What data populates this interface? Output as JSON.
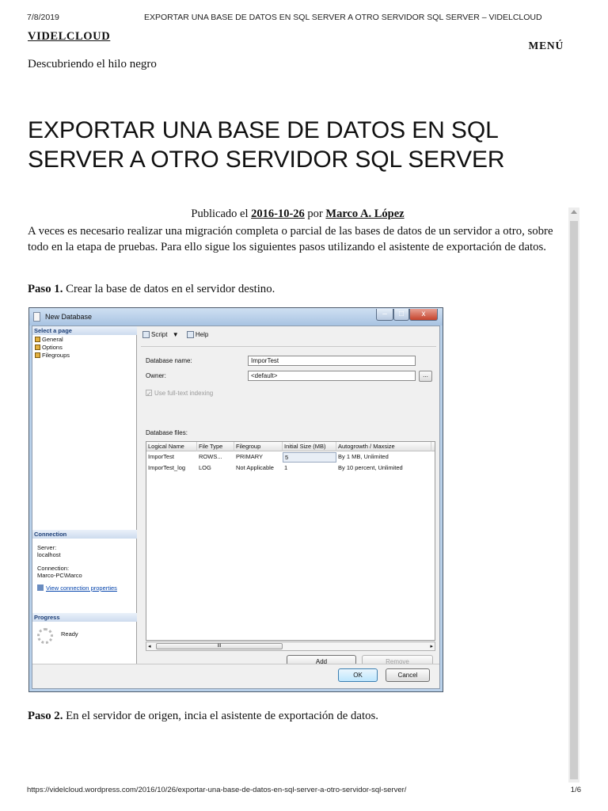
{
  "print_header": {
    "date": "7/8/2019",
    "title": "EXPORTAR UNA BASE DE DATOS EN SQL SERVER A OTRO SERVIDOR SQL SERVER – VIDELCLOUD"
  },
  "site": {
    "title": "VIDELCLOUD",
    "tagline": "Descubriendo el hilo negro",
    "menu_label": "MENÚ"
  },
  "post": {
    "title": "EXPORTAR UNA BASE DE DATOS EN SQL SERVER A OTRO SERVIDOR SQL SERVER",
    "meta_prefix": "Publicado el",
    "date": "2016-10-26",
    "meta_by": "por",
    "author": "Marco A. López",
    "intro": "A veces es necesario realizar una migración completa o parcial de las bases de datos de un servidor a otro, sobre todo en la etapa de pruebas. Para ello sigue los siguientes pasos utilizando el asistente de exportación de datos.",
    "step1_label": "Paso 1.",
    "step1_text": "Crear la base de datos en el servidor destino.",
    "step2_label": "Paso 2.",
    "step2_text": "En el servidor de origen, incia el asistente de exportación de datos."
  },
  "dialog": {
    "title": "New Database",
    "select_page_header": "Select a page",
    "pages": [
      "General",
      "Options",
      "Filegroups"
    ],
    "connection_header": "Connection",
    "server_label": "Server:",
    "server_value": "localhost",
    "connection_label": "Connection:",
    "connection_value": "Marco-PC\\Marco",
    "view_connection_link": "View connection properties",
    "progress_header": "Progress",
    "progress_status": "Ready",
    "toolbar": {
      "script": "Script",
      "script_arrow": "▼",
      "help": "Help"
    },
    "db_name_label": "Database name:",
    "db_name_value": "ImporTest",
    "owner_label": "Owner:",
    "owner_value": "<default>",
    "browse_label": "...",
    "fulltext_label": "Use full-text indexing",
    "db_files_label": "Database files:",
    "columns": [
      "Logical Name",
      "File Type",
      "Filegroup",
      "Initial Size (MB)",
      "Autogrowth / Maxsize"
    ],
    "rows": [
      [
        "ImporTest",
        "ROWS...",
        "PRIMARY",
        "5",
        "By 1 MB, Unlimited"
      ],
      [
        "ImporTest_log",
        "LOG",
        "Not Applicable",
        "1",
        "By 10 percent, Unlimited"
      ]
    ],
    "scroll_grip": "III",
    "scroll_left": "◂",
    "scroll_right": "▸",
    "add_label": "Add",
    "remove_label": "Remove",
    "ok_label": "OK",
    "cancel_label": "Cancel",
    "close_glyph": "x",
    "min_glyph": "–",
    "max_glyph": "□"
  },
  "print_footer": {
    "url": "https://videlcloud.wordpress.com/2016/10/26/exportar-una-base-de-datos-en-sql-server-a-otro-servidor-sql-server/",
    "page": "1/6"
  }
}
